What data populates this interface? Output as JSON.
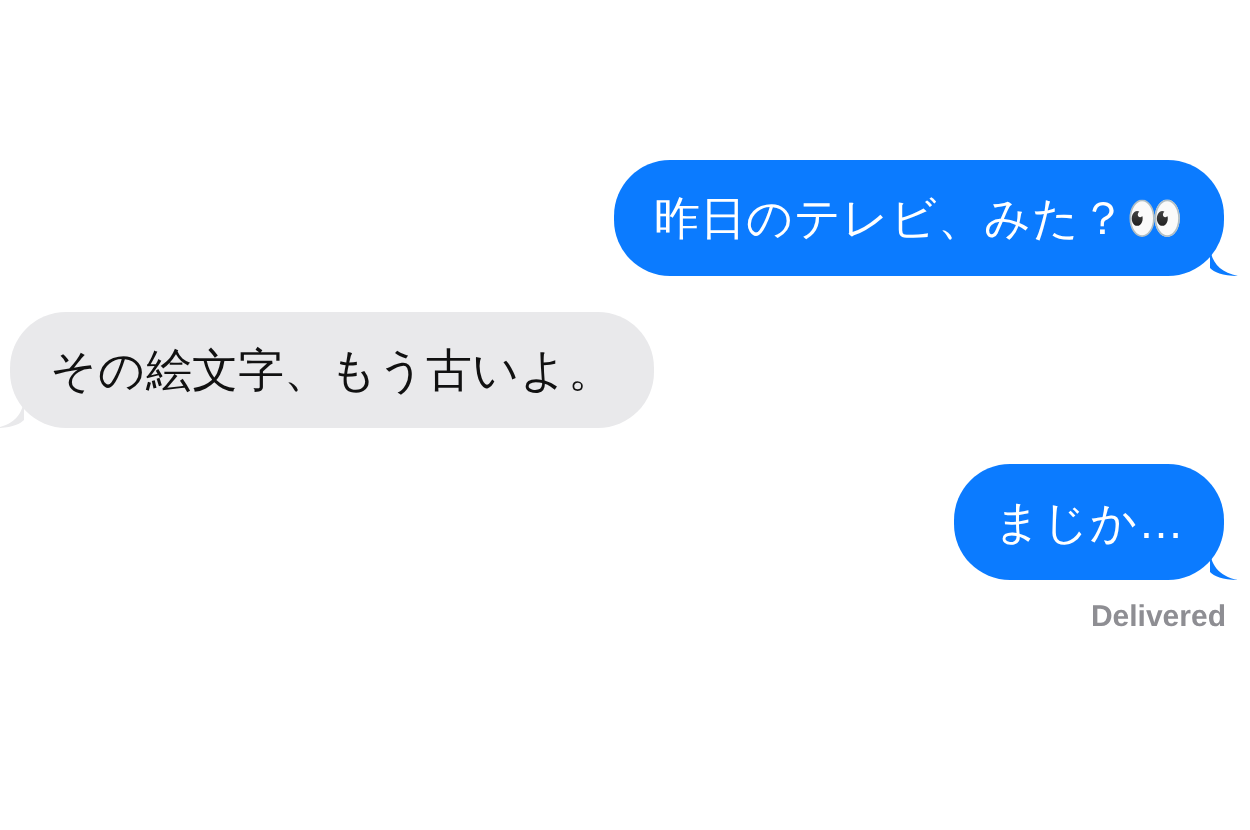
{
  "messages": [
    {
      "kind": "outgoing",
      "text": "昨日のテレビ、みた？👀"
    },
    {
      "kind": "incoming",
      "text": "その絵文字、もう古いよ。"
    },
    {
      "kind": "outgoing",
      "text": "まじか…"
    }
  ],
  "status": "Delivered"
}
